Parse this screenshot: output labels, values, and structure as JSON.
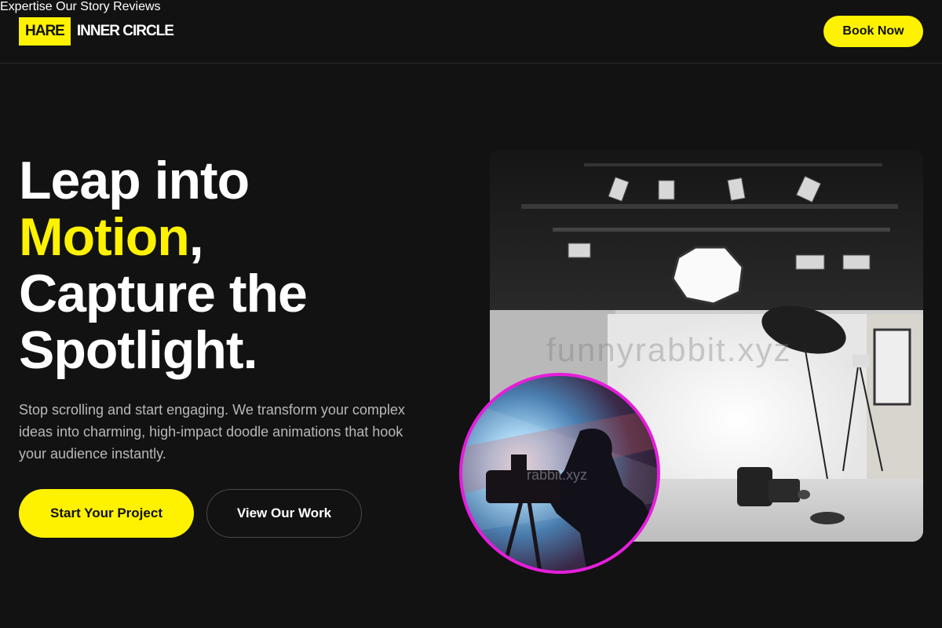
{
  "header": {
    "logo_box": "HARE",
    "logo_text": "INNER CIRCLE",
    "nav": [
      "Expertise",
      "Our Story",
      "Reviews"
    ],
    "cta": "Book Now"
  },
  "hero": {
    "line1": "Leap into",
    "line2_highlight": "Motion",
    "line2_rest": ",",
    "line3": "Capture the",
    "line4": "Spotlight.",
    "subtitle": "Stop scrolling and start engaging. We transform your complex ideas into charming, high-impact doodle animations that hook your audience instantly.",
    "primary_button": "Start Your Project",
    "secondary_button": "View Our Work"
  },
  "media": {
    "studio_watermark": "funnyrabbit.xyz",
    "circle_watermark": "rabbit.xyz"
  },
  "colors": {
    "background": "#121212",
    "accent": "#fff200",
    "circle_border": "#e61edc"
  }
}
